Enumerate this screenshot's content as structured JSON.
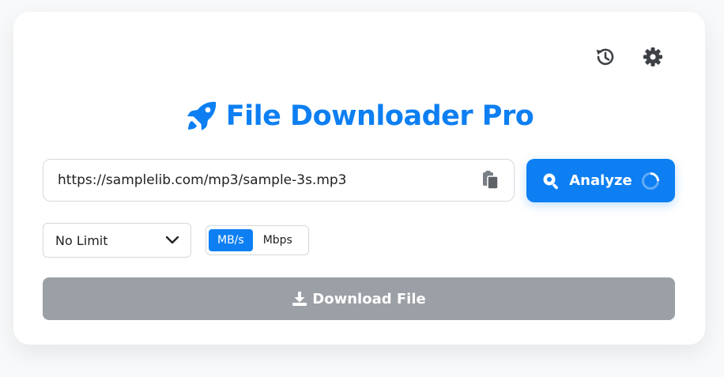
{
  "app": {
    "title": "File Downloader Pro",
    "accent_color": "#0d7ff2",
    "disabled_color": "#9ba0a6"
  },
  "toolbar": {
    "history_icon": "history-icon",
    "settings_icon": "gear-icon"
  },
  "url_input": {
    "value": "https://samplelib.com/mp3/sample-3s.mp3",
    "paste_icon": "paste-icon"
  },
  "analyze_button": {
    "label": "Analyze",
    "icon": "search-icon",
    "state": "loading"
  },
  "speed_limit": {
    "selected": "No Limit"
  },
  "unit_toggle": {
    "options": [
      "MB/s",
      "Mbps"
    ],
    "selected": "MB/s"
  },
  "download_button": {
    "label": "Download File",
    "icon": "download-icon",
    "state": "disabled"
  }
}
